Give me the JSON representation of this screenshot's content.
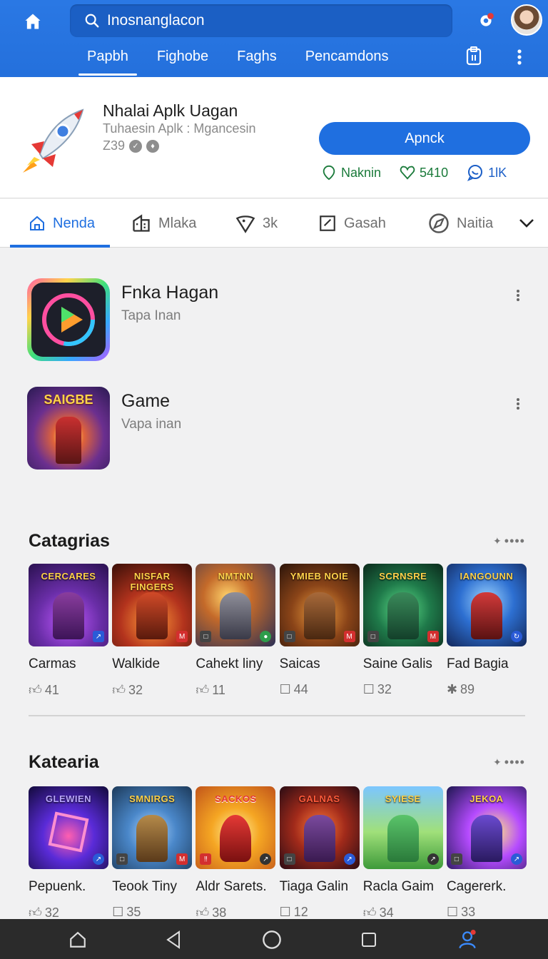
{
  "header": {
    "search_text": "Inosnanglacon",
    "tabs": [
      {
        "label": "Papbh",
        "active": true
      },
      {
        "label": "Fighobe",
        "active": false
      },
      {
        "label": "Faghs",
        "active": false
      },
      {
        "label": "Pencamdons",
        "active": false
      }
    ],
    "accent_color": "#2a78e4"
  },
  "app": {
    "title": "Nhalai Aplk Uagan",
    "subtitle": "Tuhaesin Aplk : Mgancesin",
    "rating": "Z39",
    "install_label": "Apnck",
    "stats": [
      {
        "icon": "location-icon",
        "value": "Naknin"
      },
      {
        "icon": "heart-icon",
        "value": "5410"
      },
      {
        "icon": "chat-icon",
        "value": "1lK"
      }
    ]
  },
  "category_tabs": [
    {
      "icon": "home-icon",
      "label": "Nenda",
      "active": true
    },
    {
      "icon": "building-icon",
      "label": "Mlaka",
      "active": false
    },
    {
      "icon": "pin-icon",
      "label": "3k",
      "active": false
    },
    {
      "icon": "edit-icon",
      "label": "Gasah",
      "active": false
    },
    {
      "icon": "compass-icon",
      "label": "Naitia",
      "active": false
    }
  ],
  "featured": [
    {
      "title": "Fnka Hagan",
      "subtitle": "Tapa Inan"
    },
    {
      "title": "Game",
      "subtitle": "Vapa inan"
    }
  ],
  "sections": [
    {
      "title": "Catagrias",
      "items": [
        {
          "name": "Carmas",
          "count": "41",
          "thumb_text": "CERCARES",
          "count_icon": "like-icon"
        },
        {
          "name": "Walkide",
          "count": "32",
          "thumb_text": "NISFAR FINGERS",
          "count_icon": "like-icon"
        },
        {
          "name": "Cahekt liny",
          "count": "11",
          "thumb_text": "NMTNN",
          "count_icon": "like-icon"
        },
        {
          "name": "Saicas",
          "count": "44",
          "thumb_text": "YMIEB NOIE",
          "count_icon": "square-icon"
        },
        {
          "name": "Saine Galis",
          "count": "32",
          "thumb_text": "SCRNSRE",
          "count_icon": "square-icon"
        },
        {
          "name": "Fad Bagia",
          "count": "89",
          "thumb_text": "IANGOUNN",
          "count_icon": "star-icon"
        }
      ]
    },
    {
      "title": "Katearia",
      "items": [
        {
          "name": "Pepuenk.",
          "count": "32",
          "thumb_text": "GLEWIEN",
          "count_icon": "like-icon"
        },
        {
          "name": "Teook Tiny",
          "count": "35",
          "thumb_text": "SMNIRGS",
          "count_icon": "square-icon"
        },
        {
          "name": "Aldr Sarets.",
          "count": "38",
          "thumb_text": "SACKOS",
          "count_icon": "like-icon"
        },
        {
          "name": "Tiaga Galin",
          "count": "12",
          "thumb_text": "GALNAS",
          "count_icon": "square-icon"
        },
        {
          "name": "Racla Gaim",
          "count": "34",
          "thumb_text": "SYIESE",
          "count_icon": "like-icon"
        },
        {
          "name": "Cagererk.",
          "count": "33",
          "thumb_text": "JEKOA",
          "count_icon": "square-icon"
        }
      ]
    }
  ]
}
